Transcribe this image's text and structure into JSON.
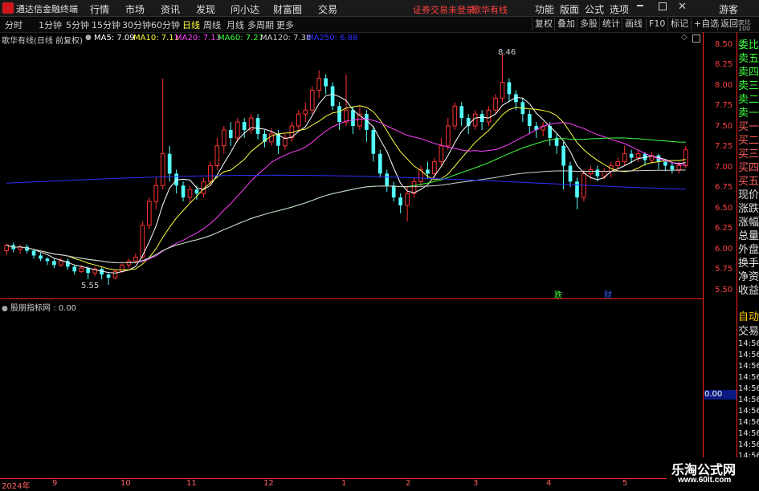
{
  "app": {
    "title": "通达信金融终端"
  },
  "menu": [
    "行情",
    "市场",
    "资讯",
    "发现",
    "问小达",
    "财富圈",
    "交易"
  ],
  "status": {
    "login": "证券交易未登录",
    "broker": "歌华有线"
  },
  "right_menu": [
    "功能",
    "版面",
    "公式",
    "选项"
  ],
  "user": "游客",
  "periods": [
    "分时",
    "1分钟",
    "5分钟",
    "15分钟",
    "30分钟",
    "60分钟",
    "日线",
    "周线",
    "月线",
    "多周期",
    "更多"
  ],
  "toolbar_buttons": [
    "复权",
    "叠加",
    "多股",
    "统计",
    "画线",
    "F10",
    "标记",
    "+自选",
    "返回"
  ],
  "info": {
    "stock": "歌华有线(日线 前复权)",
    "ma": [
      {
        "label": "MA5: 7.09",
        "color": "#ffffff"
      },
      {
        "label": "MA10: 7.11",
        "color": "#ffff40"
      },
      {
        "label": "MA20: 7.13",
        "color": "#ff40ff"
      },
      {
        "label": "MA60: 7.27",
        "color": "#40ff40"
      },
      {
        "label": "MA120: 7.38",
        "color": "#d0d0d0"
      },
      {
        "label": "MA250: 6.88",
        "color": "#3030ff"
      }
    ]
  },
  "annotations": {
    "high": "8.46",
    "low": "5.55",
    "die": "跌",
    "cai": "财"
  },
  "price_ticks": [
    "8.50",
    "8.25",
    "8.00",
    "7.75",
    "7.50",
    "7.25",
    "7.00",
    "6.75",
    "6.50",
    "6.25",
    "6.00",
    "5.75",
    "5.50"
  ],
  "sub": {
    "label": "股朋指标网 : 0.00",
    "value": "0.00"
  },
  "dates": [
    "2024年",
    "9",
    "10",
    "11",
    "12",
    "1",
    "2",
    "3",
    "4",
    "5"
  ],
  "side_labels": [
    "委比",
    "卖五",
    "卖四",
    "卖三",
    "卖二",
    "卖一",
    "买一",
    "买二",
    "买三",
    "买四",
    "买五",
    "现价",
    "涨跌",
    "涨幅",
    "总量",
    "外盘",
    "换手",
    "净资",
    "收益"
  ],
  "side_labels2": [
    "自动",
    "交易"
  ],
  "side_top": "委比 100",
  "side_times": [
    "14:56",
    "14:56",
    "14:56",
    "14:56",
    "14:56",
    "14:56",
    "14:56",
    "14:56",
    "14:56",
    "14:56",
    "14:56"
  ],
  "watermark": {
    "line1": "乐淘公式网",
    "line2": "www.60lt.com"
  },
  "chart_data": {
    "type": "candlestick",
    "ylim": [
      5.45,
      8.58
    ],
    "candles": [
      [
        5.98,
        6.05,
        5.92,
        6.07
      ],
      [
        6.05,
        6.0,
        5.96,
        6.08
      ],
      [
        6.0,
        6.03,
        5.94,
        6.06
      ],
      [
        6.03,
        5.98,
        5.95,
        6.06
      ],
      [
        5.98,
        5.92,
        5.88,
        6.0
      ],
      [
        5.92,
        5.88,
        5.85,
        5.95
      ],
      [
        5.88,
        5.85,
        5.8,
        5.9
      ],
      [
        5.85,
        5.8,
        5.76,
        5.88
      ],
      [
        5.8,
        5.85,
        5.78,
        5.89
      ],
      [
        5.85,
        5.78,
        5.74,
        5.88
      ],
      [
        5.78,
        5.72,
        5.68,
        5.8
      ],
      [
        5.72,
        5.76,
        5.7,
        5.8
      ],
      [
        5.76,
        5.7,
        5.62,
        5.78
      ],
      [
        5.7,
        5.75,
        5.66,
        5.78
      ],
      [
        5.75,
        5.68,
        5.62,
        5.77
      ],
      [
        5.68,
        5.64,
        5.55,
        5.7
      ],
      [
        5.64,
        5.72,
        5.62,
        5.74
      ],
      [
        5.72,
        5.8,
        5.7,
        5.82
      ],
      [
        5.8,
        5.85,
        5.76,
        5.88
      ],
      [
        5.85,
        5.9,
        5.82,
        5.95
      ],
      [
        5.9,
        6.3,
        5.88,
        6.35
      ],
      [
        6.3,
        6.6,
        6.25,
        6.65
      ],
      [
        6.6,
        6.8,
        6.5,
        6.9
      ],
      [
        6.8,
        7.2,
        6.75,
        8.15
      ],
      [
        7.2,
        6.95,
        6.85,
        7.3
      ],
      [
        6.95,
        6.8,
        6.7,
        7.0
      ],
      [
        6.8,
        6.65,
        6.6,
        6.85
      ],
      [
        6.65,
        6.75,
        6.58,
        6.8
      ],
      [
        6.75,
        6.7,
        6.62,
        6.8
      ],
      [
        6.7,
        6.85,
        6.65,
        6.9
      ],
      [
        6.85,
        7.05,
        6.8,
        7.1
      ],
      [
        7.05,
        7.3,
        7.0,
        7.4
      ],
      [
        7.3,
        7.5,
        7.2,
        7.55
      ],
      [
        7.5,
        7.4,
        7.3,
        7.6
      ],
      [
        7.4,
        7.6,
        7.35,
        7.65
      ],
      [
        7.6,
        7.5,
        7.4,
        7.65
      ],
      [
        7.5,
        7.65,
        7.45,
        7.7
      ],
      [
        7.65,
        7.45,
        7.38,
        7.7
      ],
      [
        7.45,
        7.35,
        7.28,
        7.5
      ],
      [
        7.35,
        7.45,
        7.3,
        7.52
      ],
      [
        7.45,
        7.3,
        7.2,
        7.5
      ],
      [
        7.3,
        7.4,
        7.25,
        7.45
      ],
      [
        7.4,
        7.55,
        7.35,
        7.6
      ],
      [
        7.55,
        7.7,
        7.5,
        7.75
      ],
      [
        7.7,
        7.75,
        7.6,
        7.85
      ],
      [
        7.75,
        8.0,
        7.7,
        8.05
      ],
      [
        8.0,
        8.15,
        7.9,
        8.25
      ],
      [
        8.15,
        8.05,
        7.95,
        8.2
      ],
      [
        8.05,
        7.8,
        7.75,
        8.1
      ],
      [
        7.8,
        7.6,
        7.5,
        7.85
      ],
      [
        7.6,
        7.75,
        7.55,
        8.2
      ],
      [
        7.75,
        7.55,
        7.45,
        7.8
      ],
      [
        7.55,
        7.7,
        7.5,
        7.8
      ],
      [
        7.7,
        7.5,
        7.35,
        7.75
      ],
      [
        7.5,
        7.2,
        7.1,
        7.55
      ],
      [
        7.2,
        6.95,
        6.9,
        7.25
      ],
      [
        6.95,
        6.8,
        6.72,
        7.0
      ],
      [
        6.8,
        6.65,
        6.6,
        6.85
      ],
      [
        6.65,
        6.55,
        6.45,
        6.7
      ],
      [
        6.55,
        6.7,
        6.35,
        6.8
      ],
      [
        6.7,
        6.85,
        6.65,
        6.9
      ],
      [
        6.85,
        7.0,
        6.8,
        7.05
      ],
      [
        7.0,
        6.95,
        6.88,
        7.1
      ],
      [
        6.95,
        7.1,
        6.9,
        7.15
      ],
      [
        7.1,
        7.3,
        7.05,
        7.4
      ],
      [
        7.3,
        7.55,
        7.25,
        7.65
      ],
      [
        7.55,
        7.8,
        7.5,
        7.85
      ],
      [
        7.8,
        7.65,
        7.55,
        7.85
      ],
      [
        7.65,
        7.55,
        7.45,
        7.7
      ],
      [
        7.55,
        7.7,
        7.5,
        7.75
      ],
      [
        7.7,
        7.6,
        7.5,
        7.75
      ],
      [
        7.6,
        7.75,
        7.55,
        7.8
      ],
      [
        7.75,
        7.9,
        7.7,
        7.95
      ],
      [
        7.9,
        8.1,
        7.85,
        8.46
      ],
      [
        8.1,
        7.95,
        7.85,
        8.15
      ],
      [
        7.95,
        7.85,
        7.75,
        8.0
      ],
      [
        7.85,
        7.7,
        7.6,
        7.9
      ],
      [
        7.7,
        7.55,
        7.45,
        7.75
      ],
      [
        7.55,
        7.5,
        7.4,
        7.6
      ],
      [
        7.5,
        7.55,
        7.42,
        7.6
      ],
      [
        7.55,
        7.4,
        7.3,
        7.6
      ],
      [
        7.4,
        7.3,
        7.2,
        7.45
      ],
      [
        7.3,
        7.05,
        6.75,
        7.35
      ],
      [
        7.05,
        6.85,
        6.78,
        7.1
      ],
      [
        6.85,
        6.65,
        6.5,
        6.9
      ],
      [
        6.65,
        6.95,
        6.6,
        7.0
      ],
      [
        6.95,
        7.0,
        6.88,
        7.05
      ],
      [
        7.0,
        6.92,
        6.85,
        7.05
      ],
      [
        6.92,
        6.98,
        6.88,
        7.02
      ],
      [
        6.98,
        7.05,
        6.9,
        7.1
      ],
      [
        7.05,
        7.1,
        7.0,
        7.15
      ],
      [
        7.1,
        7.2,
        7.05,
        7.3
      ],
      [
        7.2,
        7.15,
        7.08,
        7.25
      ],
      [
        7.15,
        7.2,
        7.1,
        7.25
      ],
      [
        7.2,
        7.12,
        7.05,
        7.22
      ],
      [
        7.12,
        7.18,
        7.08,
        7.22
      ],
      [
        7.18,
        7.1,
        7.0,
        7.2
      ],
      [
        7.1,
        7.05,
        6.98,
        7.12
      ],
      [
        7.05,
        7.0,
        6.95,
        7.1
      ],
      [
        7.0,
        7.05,
        6.95,
        7.1
      ],
      [
        7.05,
        7.25,
        7.02,
        7.3
      ]
    ]
  }
}
